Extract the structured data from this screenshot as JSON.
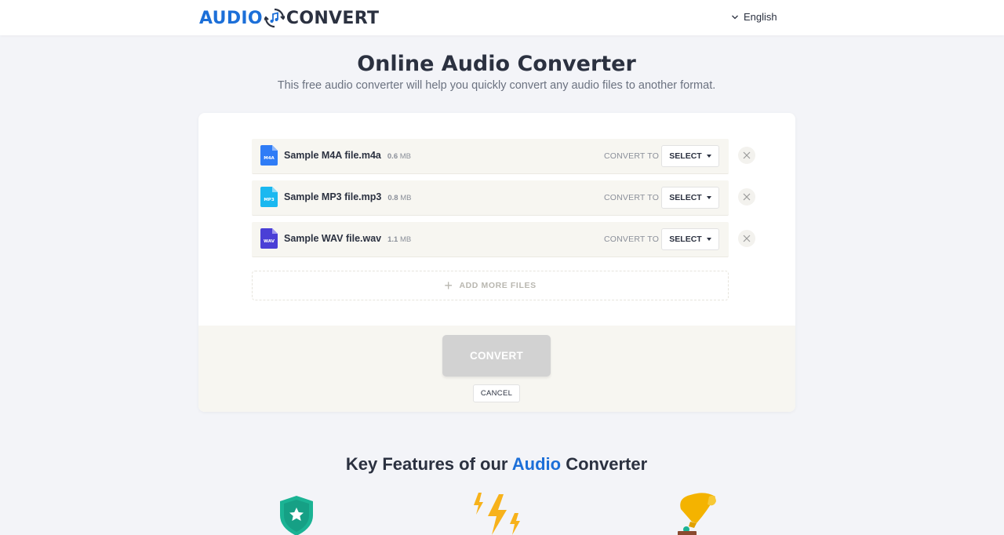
{
  "header": {
    "logo_left": "AUDIO",
    "logo_right": "CONVERT",
    "language": "English"
  },
  "hero": {
    "title": "Online Audio Converter",
    "subtitle": "This free audio converter will help you quickly convert any audio files to another format."
  },
  "files": [
    {
      "name": "Sample M4A file.m4a",
      "size_value": "0.6",
      "size_unit": "MB",
      "icon_label": "M4A",
      "icon_color": "#2f7cf6",
      "convert_to_label": "CONVERT TO",
      "select_label": "SELECT"
    },
    {
      "name": "Sample MP3 file.mp3",
      "size_value": "0.8",
      "size_unit": "MB",
      "icon_label": "MP3",
      "icon_color": "#1ab8f0",
      "convert_to_label": "CONVERT TO",
      "select_label": "SELECT"
    },
    {
      "name": "Sample WAV file.wav",
      "size_value": "1.1",
      "size_unit": "MB",
      "icon_label": "WAV",
      "icon_color": "#4a3fd6",
      "convert_to_label": "CONVERT TO",
      "select_label": "SELECT"
    }
  ],
  "actions": {
    "add_more": "ADD MORE FILES",
    "convert": "CONVERT",
    "cancel": "CANCEL"
  },
  "features": {
    "title_prefix": "Key Features of our",
    "title_highlight": "Audio",
    "title_suffix": "Converter",
    "icons": [
      "shield-star-icon",
      "lightning-icon",
      "gramophone-icon"
    ]
  },
  "colors": {
    "accent": "#1c6fd8",
    "text": "#2b3140",
    "footer_bg": "#f7f6f1"
  }
}
